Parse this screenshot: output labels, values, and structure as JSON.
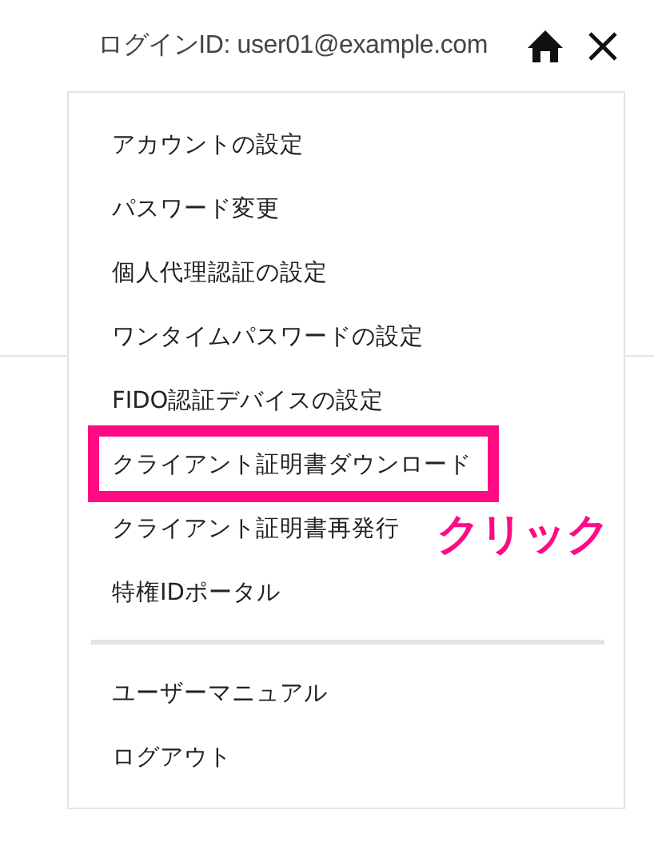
{
  "header": {
    "login_id": "ログインID: user01@example.com"
  },
  "menu": {
    "groups": [
      {
        "items": [
          {
            "label": "アカウントの設定",
            "highlighted": false
          },
          {
            "label": "パスワード変更",
            "highlighted": false
          },
          {
            "label": "個人代理認証の設定",
            "highlighted": false
          },
          {
            "label": "ワンタイムパスワードの設定",
            "highlighted": false
          },
          {
            "label": "FIDO認証デバイスの設定",
            "highlighted": false
          },
          {
            "label": "クライアント証明書ダウンロード",
            "highlighted": true
          },
          {
            "label": "クライアント証明書再発行",
            "highlighted": false
          },
          {
            "label": "特権IDポータル",
            "highlighted": false
          }
        ]
      },
      {
        "items": [
          {
            "label": "ユーザーマニュアル",
            "highlighted": false
          },
          {
            "label": "ログアウト",
            "highlighted": false
          }
        ]
      }
    ]
  },
  "annotation": {
    "text": "クリック"
  }
}
